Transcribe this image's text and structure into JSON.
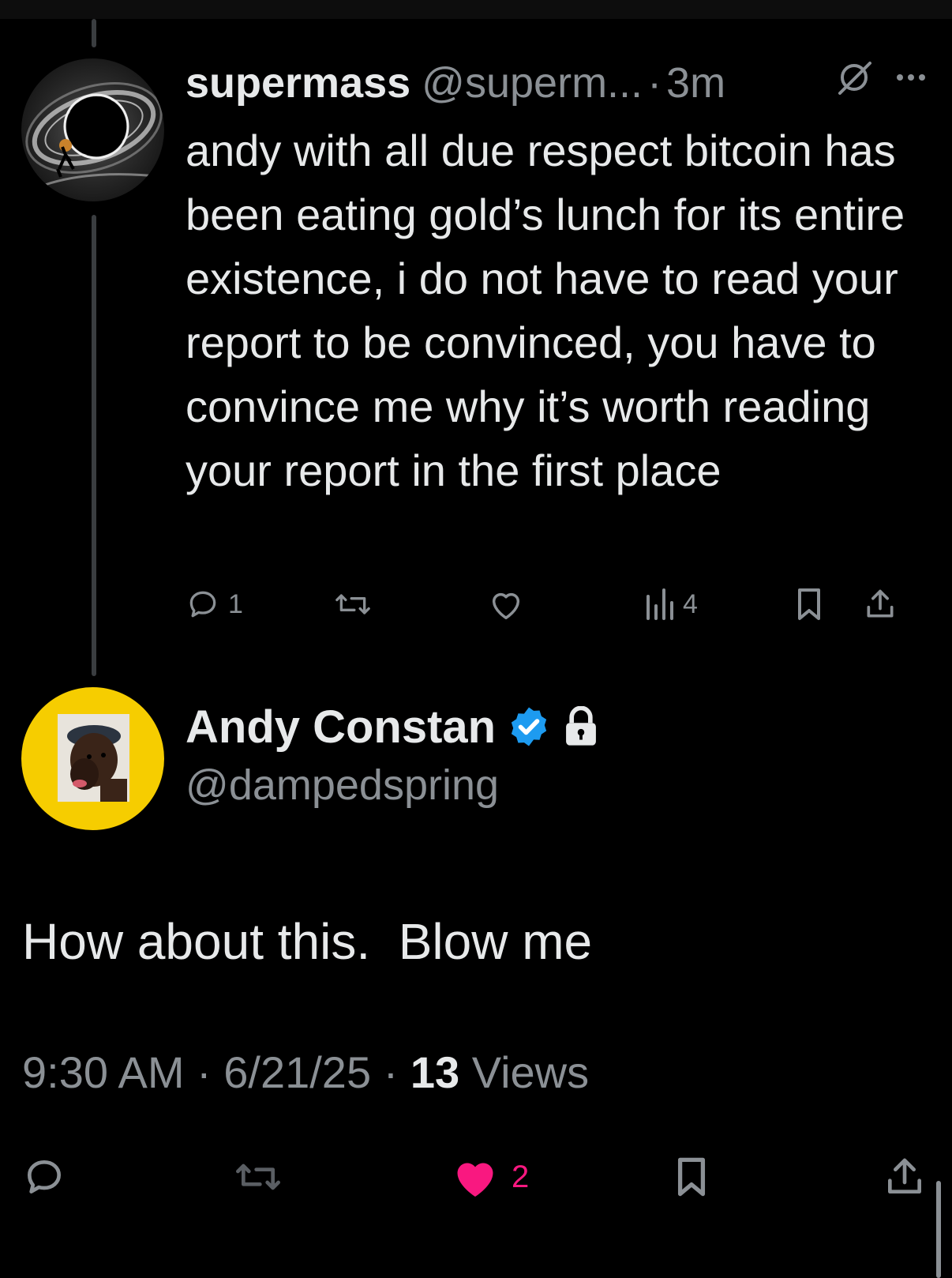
{
  "reply": {
    "display_name": "supermass",
    "handle": "@superm...",
    "separator": "·",
    "time": "3m",
    "text": "andy with all due respect bitcoin has been eating gold’s lunch for its entire existence, i do not have to read your report to be convinced, you have to convince me why it’s worth reading your report in the first place",
    "icons": {
      "avatar": "black-hole-avatar-icon",
      "grok": "grok-icon",
      "more": "more-icon"
    },
    "actions": {
      "reply_count": "1",
      "views_count": "4"
    }
  },
  "main": {
    "display_name": "Andy Constan",
    "handle": "@dampedspring",
    "text": "How about this.  Blow me",
    "time": "9:30 AM",
    "date": "6/21/25",
    "separator": "·",
    "views_count": "13",
    "views_label": "Views",
    "like_count": "2",
    "colors": {
      "verified": "#1d9bf0",
      "like": "#f91880",
      "avatar_ring": "#f6cd00"
    }
  }
}
